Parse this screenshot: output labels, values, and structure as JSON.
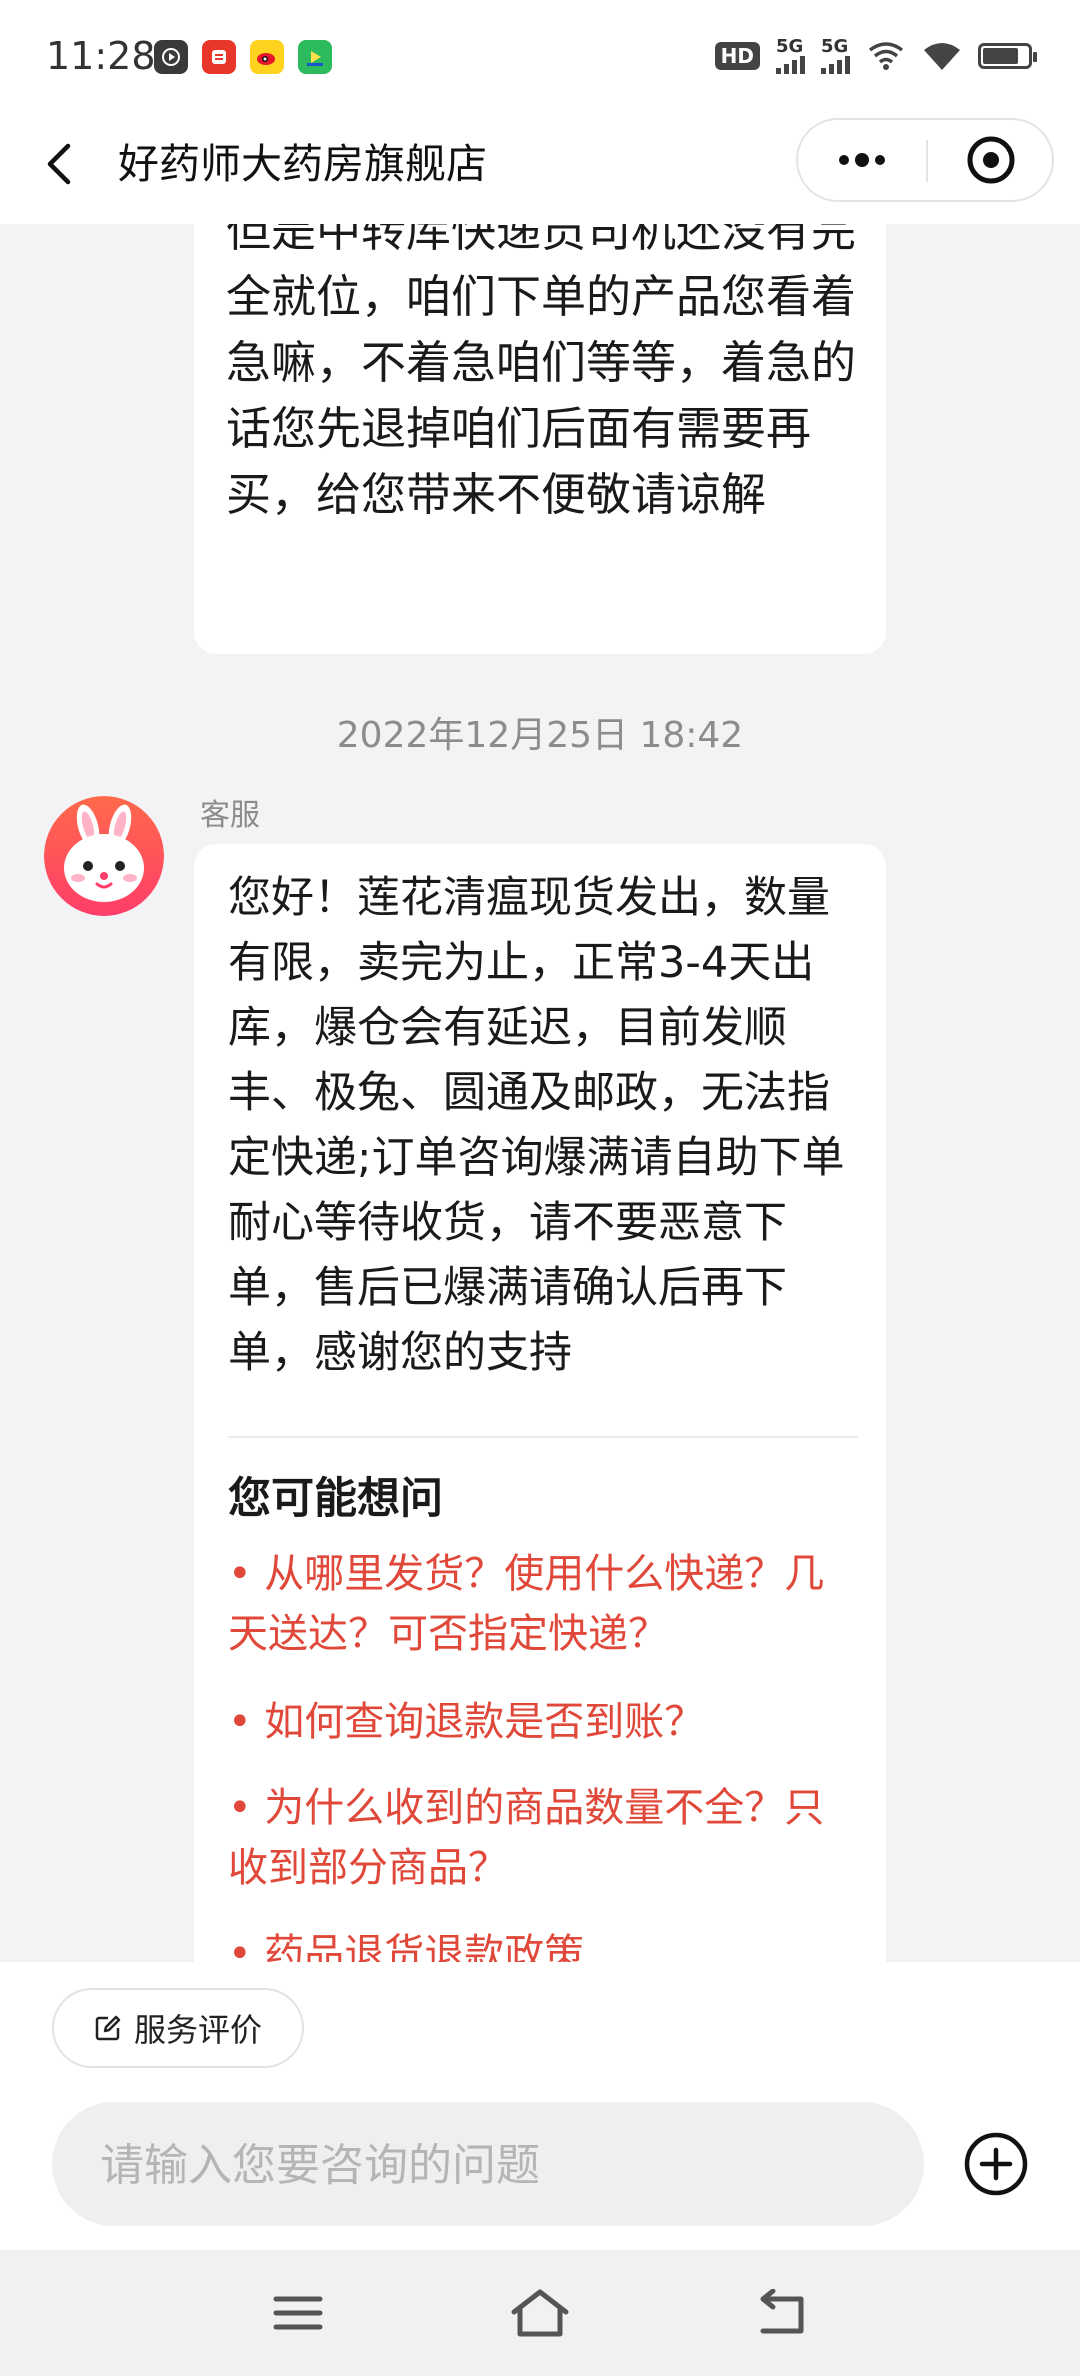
{
  "status_bar": {
    "time": "11:28",
    "hd_label": "HD",
    "signal_1_label": "5G",
    "signal_2_label": "5G",
    "battery_level": 0.8,
    "app_icons": [
      "play-icon",
      "news-app-icon",
      "weibo-icon",
      "video-app-icon"
    ]
  },
  "header": {
    "title": "好药师大药房旗舰店"
  },
  "messages": [
    {
      "text": "但是中转库快递员司机还没有完全就位，咱们下单的产品您看着急嘛，不着急咱们等等，着急的话您先退掉咱们后面有需要再买，给您带来不便敬请谅解"
    }
  ],
  "timestamp": "2022年12月25日 18:42",
  "agent_message": {
    "sender": "客服",
    "text": "您好！莲花清瘟现货发出，数量有限，卖完为止，正常3-4天出库，爆仓会有延迟，目前发顺丰、极兔、圆通及邮政，无法指定快递;订单咨询爆满请自助下单耐心等待收货，请不要恶意下单，售后已爆满请确认后再下单，感谢您的支持",
    "faq_title": "您可能想问",
    "faq_items": [
      "• 从哪里发货？使用什么快递？几天送达？可否指定快递？",
      "• 如何查询退款是否到账？",
      "• 为什么收到的商品数量不全？只收到部分商品？",
      "• 药品退货退款政策"
    ]
  },
  "bottom": {
    "rate_label": "服务评价",
    "input_placeholder": "请输入您要咨询的问题"
  },
  "colors": {
    "accent_red": "#e0483a",
    "page_bg": "#f3f3f5",
    "bubble_bg": "#ffffff"
  }
}
